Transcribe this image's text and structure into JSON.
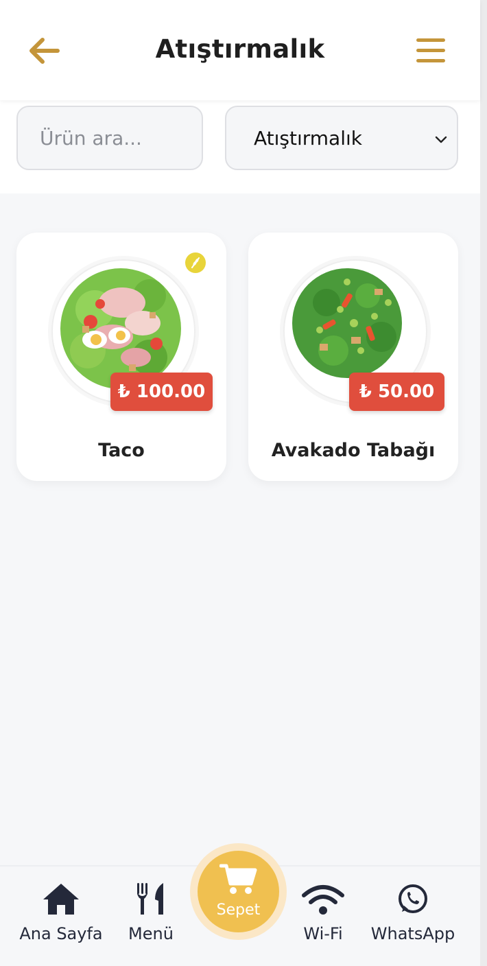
{
  "header": {
    "title": "Atıştırmalık",
    "back_icon": "arrow-left-icon",
    "menu_icon": "hamburger-icon",
    "accent_color": "#c4953a"
  },
  "filters": {
    "search_placeholder": "Ürün ara...",
    "search_value": "",
    "category_selected": "Atıştırmalık"
  },
  "products": [
    {
      "name": "Taco",
      "price": "₺ 100.00",
      "image": "salad-bacon-egg-plate",
      "tag_icon": "wheat-icon"
    },
    {
      "name": "Avakado Tabağı",
      "price": "₺ 50.00",
      "image": "spinach-edamame-plate"
    }
  ],
  "bottom_nav": {
    "home": {
      "label": "Ana Sayfa",
      "icon": "home-icon"
    },
    "menu": {
      "label": "Menü",
      "icon": "fork-knife-icon"
    },
    "cart": {
      "label": "Sepet",
      "icon": "cart-icon"
    },
    "wifi": {
      "label": "Wi-Fi",
      "icon": "wifi-icon"
    },
    "whatsapp": {
      "label": "WhatsApp",
      "icon": "whatsapp-icon"
    }
  },
  "colors": {
    "price_badge": "#e04e3d",
    "cart_button": "#f0c050",
    "nav_icon": "#24293a"
  }
}
